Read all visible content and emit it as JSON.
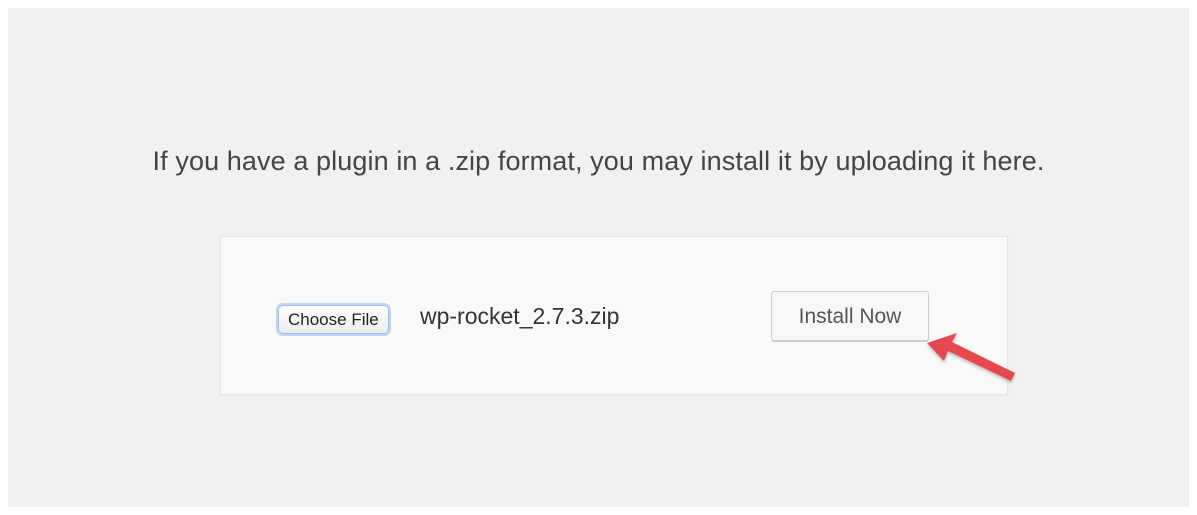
{
  "page": {
    "instructions": "If you have a plugin in a .zip format, you may install it by uploading it here."
  },
  "upload": {
    "choose_file_label": "Choose File",
    "selected_file": "wp-rocket_2.7.3.zip",
    "install_button_label": "Install Now"
  },
  "annotation": {
    "arrow_icon": "red-pointer-arrow",
    "arrow_color": "#e5494f"
  },
  "colors": {
    "page_background": "#f1f1f1",
    "box_background": "#f9f9f9",
    "text": "#444444"
  }
}
